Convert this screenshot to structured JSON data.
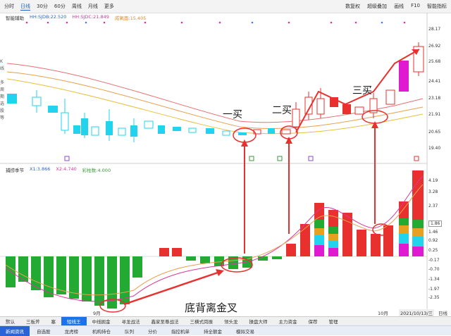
{
  "toolbar": {
    "tabs": [
      "分时",
      "日线",
      "30分",
      "60分",
      "周线",
      "月线",
      "更多"
    ],
    "right_items": [
      "数复权",
      "超级叠加",
      "画线",
      "F10",
      "智能指标"
    ]
  },
  "indicator_top": {
    "name": "智能辅助",
    "values": [
      "HH:SJDB:22.520",
      "HH:SJDC:21.849",
      "成氧面:15.405"
    ]
  },
  "indicator_bottom": {
    "name": "捕捞季节",
    "values": [
      "X1:3.866",
      "X2:4.740",
      "彩柱数:4.000"
    ]
  },
  "sidebar_labels": [
    "K",
    "线",
    "多",
    "周",
    "期",
    "选",
    "股",
    "等"
  ],
  "price_axis": [
    "28.17",
    "26.92",
    "25.68",
    "24.41",
    "23.18",
    "21.91",
    "20.65",
    "19.40"
  ],
  "indicator_axis": [
    "4.19",
    "3.28",
    "2.37",
    "1.86",
    "1.46",
    "0.92",
    "0.25",
    "-0.17",
    "-0.70",
    "-1.34",
    "-1.97",
    "-2.35"
  ],
  "annotations": {
    "buy1": "一买",
    "buy2": "二买",
    "buy3": "三买",
    "divergence": "底背离金叉"
  },
  "x_dates": {
    "left": "9月",
    "mid": "10月",
    "current": "2021/10/13/三",
    "period": "日线"
  },
  "bottom_tabs": [
    "默认",
    "三板斧",
    "塞",
    "短线王",
    "中线掘金",
    "寻龙战法",
    "鑫家至尊战法",
    "三横式岗振",
    "领头龙",
    "操盘大师",
    "主力资金",
    "保荐",
    "管理"
  ],
  "bottom_nav": [
    "新闻资讯",
    "自选股",
    "龙虎榜",
    "机构持仓",
    "队列",
    "分价",
    "指控机单",
    "持全额金",
    "模拟交易"
  ],
  "colors": {
    "up": "#e8302e",
    "down": "#22aa33",
    "accent": "#1a5fd1",
    "cyan": "#22d3ee",
    "magenta": "#e01ad1"
  }
}
